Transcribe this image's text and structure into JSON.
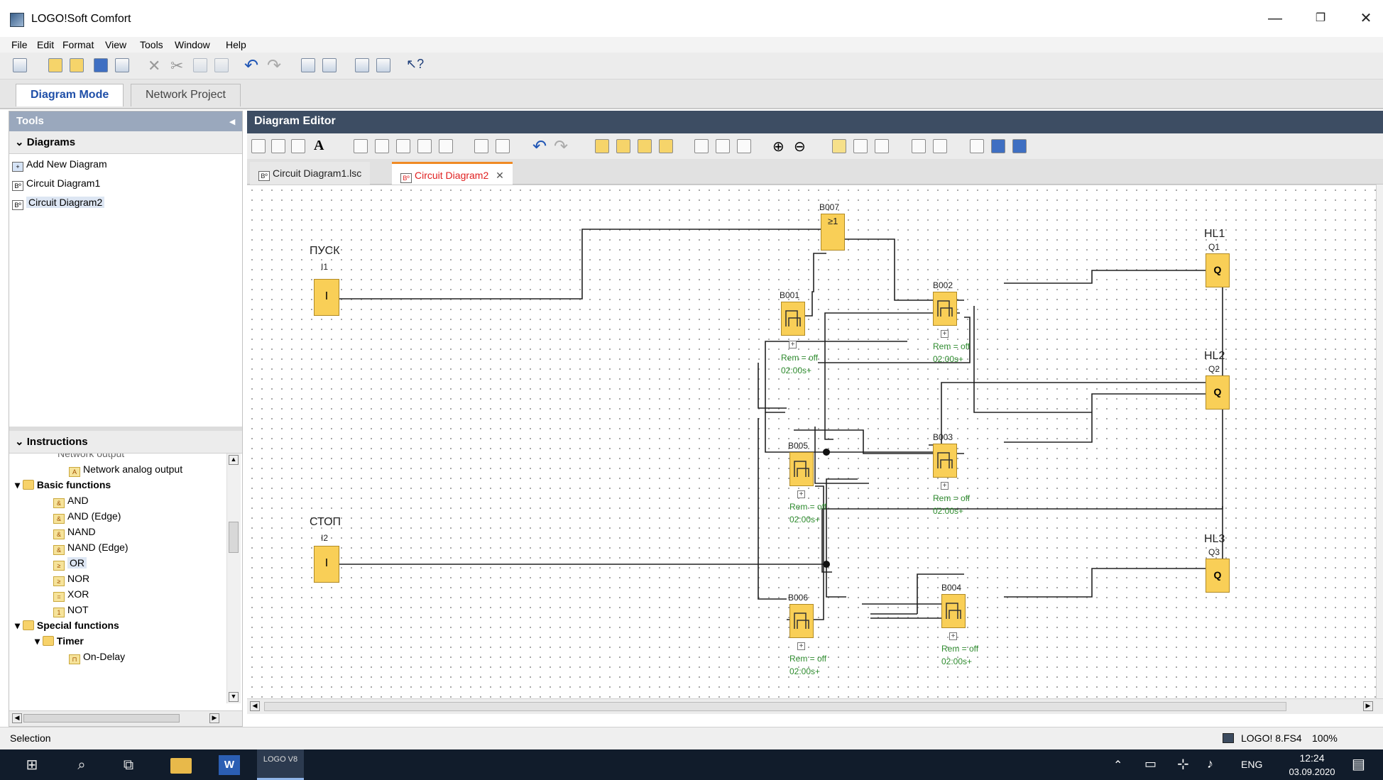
{
  "app": {
    "title": "LOGO!Soft Comfort"
  },
  "menu": [
    "File",
    "Edit",
    "Format",
    "View",
    "Tools",
    "Window",
    "Help"
  ],
  "mode_tabs": {
    "diagram": "Diagram Mode",
    "network": "Network Project"
  },
  "tools": {
    "header": "Tools",
    "diagrams_header": "Diagrams",
    "diagram_items": [
      "Add New Diagram",
      "Circuit Diagram1",
      "Circuit Diagram2"
    ],
    "instructions_header": "Instructions",
    "tree": {
      "partial": "Network output",
      "net_analog": "Network analog output",
      "basic": "Basic functions",
      "basic_items": [
        "AND",
        "AND (Edge)",
        "NAND",
        "NAND (Edge)",
        "OR",
        "NOR",
        "XOR",
        "NOT"
      ],
      "special": "Special functions",
      "timer": "Timer",
      "ondelay": "On-Delay"
    }
  },
  "editor": {
    "header": "Diagram Editor",
    "tabs": [
      "Circuit Diagram1.lsc",
      "Circuit Diagram2"
    ],
    "close": "✕"
  },
  "diagram": {
    "inputs": [
      {
        "tag": "ПУСК",
        "id": "I1",
        "sym": "I"
      },
      {
        "tag": "СТОП",
        "id": "I2",
        "sym": "I"
      }
    ],
    "outputs": [
      {
        "tag": "HL1",
        "id": "Q1",
        "sym": "Q"
      },
      {
        "tag": "HL2",
        "id": "Q2",
        "sym": "Q"
      },
      {
        "tag": "HL3",
        "id": "Q3",
        "sym": "Q"
      }
    ],
    "or_block": {
      "id": "B007",
      "sym": "≥1"
    },
    "blocks": [
      "B001",
      "B002",
      "B003",
      "B004",
      "B005",
      "B006"
    ],
    "rem": "Rem = off",
    "time": "02:00s+",
    "plus": "+"
  },
  "status": {
    "left": "Selection",
    "device": "LOGO! 8.FS4",
    "zoom": "100%"
  },
  "taskbar": {
    "lang": "ENG",
    "time": "12:24",
    "date": "03.09.2020",
    "pinned": "LOGO V8",
    "word": "W"
  }
}
